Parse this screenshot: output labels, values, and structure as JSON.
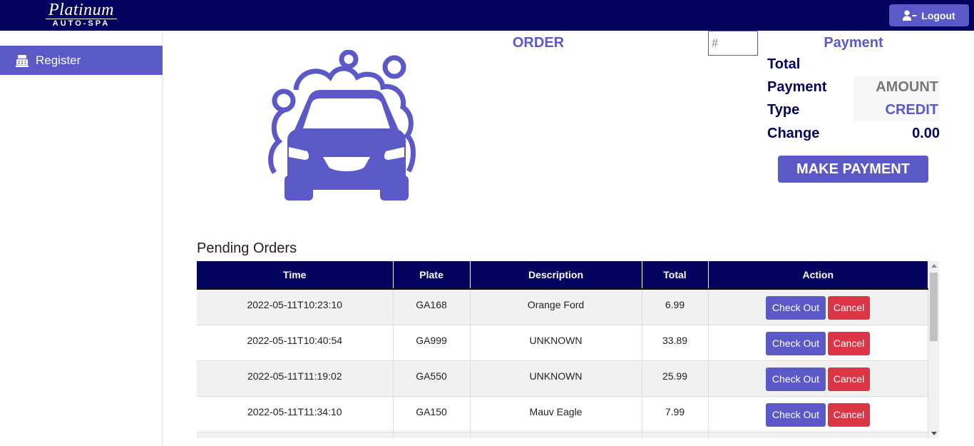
{
  "header": {
    "logo_top": "Platinum",
    "logo_bottom": "AUTO-SPA",
    "logout_label": "Logout"
  },
  "sidebar": {
    "items": [
      {
        "label": "Register",
        "icon": "cash-register-icon"
      }
    ]
  },
  "order": {
    "title": "ORDER",
    "input_placeholder": "#"
  },
  "payment": {
    "title": "Payment",
    "total_label": "Total",
    "payment_label": "Payment",
    "type_label": "Type",
    "change_label": "Change",
    "amount_value": "AMOUNT",
    "type_value": "CREDIT",
    "change_value": "0.00",
    "make_payment_label": "MAKE PAYMENT"
  },
  "pending": {
    "title": "Pending Orders",
    "columns": [
      "Time",
      "Plate",
      "Description",
      "Total",
      "Action"
    ],
    "checkout_label": "Check Out",
    "cancel_label": "Cancel",
    "rows": [
      {
        "time": "2022-05-11T10:23:10",
        "plate": "GA168",
        "description": "Orange Ford",
        "total": "6.99"
      },
      {
        "time": "2022-05-11T10:40:54",
        "plate": "GA999",
        "description": "UNKNOWN",
        "total": "33.89"
      },
      {
        "time": "2022-05-11T11:19:02",
        "plate": "GA550",
        "description": "UNKNOWN",
        "total": "25.99"
      },
      {
        "time": "2022-05-11T11:34:10",
        "plate": "GA150",
        "description": "Mauv Eagle",
        "total": "7.99"
      }
    ]
  },
  "colors": {
    "navy": "#03035f",
    "accent": "#5b58c7",
    "danger": "#dc3545"
  }
}
